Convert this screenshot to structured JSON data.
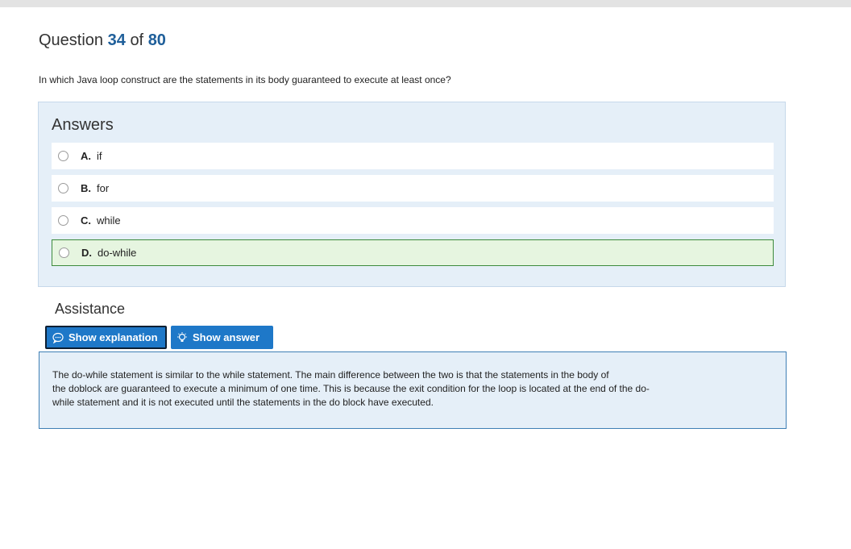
{
  "question": {
    "prefix": "Question",
    "number": "34",
    "of": "of",
    "total": "80",
    "text": "In which Java loop construct are the statements in its body guaranteed to execute at least once?"
  },
  "answers": {
    "title": "Answers",
    "options": [
      {
        "letter": "A.",
        "text": "if",
        "selected": false
      },
      {
        "letter": "B.",
        "text": "for",
        "selected": false
      },
      {
        "letter": "C.",
        "text": "while",
        "selected": false
      },
      {
        "letter": "D.",
        "text": "do-while",
        "selected": true
      }
    ]
  },
  "assistance": {
    "title": "Assistance",
    "show_explanation": "Show explanation",
    "show_answer": "Show answer",
    "explanation_lines": [
      "The do-while statement is similar to the while statement. The main difference between the two is that the statements in the body of",
      "the doblock are guaranteed to execute a minimum of one time. This is because the exit condition for the loop is located at the end of the do-",
      "while statement and it is not executed until the statements in the do block have executed."
    ]
  },
  "colors": {
    "accent": "#1e78c8",
    "question_number": "#1f5f9a",
    "panel_bg": "#e5eff8",
    "correct_bg": "#e6f5e0",
    "correct_border": "#3c8a3c"
  },
  "icons": {
    "explanation": "speech-bubble-icon",
    "answer": "lightbulb-icon"
  }
}
